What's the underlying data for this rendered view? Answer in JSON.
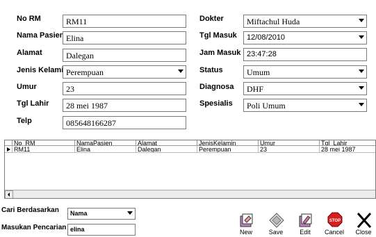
{
  "form": {
    "left": [
      {
        "label": "No RM",
        "value": "RM11",
        "type": "text"
      },
      {
        "label": "Nama Pasien",
        "value": "Elina",
        "type": "text"
      },
      {
        "label": "Alamat",
        "value": "Dalegan",
        "type": "text"
      },
      {
        "label": "Jenis Kelamin",
        "value": "Perempuan",
        "type": "select"
      },
      {
        "label": "Umur",
        "value": "23",
        "type": "text"
      },
      {
        "label": "Tgl Lahir",
        "value": "28 mei 1987",
        "type": "text"
      },
      {
        "label": "Telp",
        "value": "085648166287",
        "type": "text"
      }
    ],
    "right": [
      {
        "label": "Dokter",
        "value": "Miftachul Huda",
        "type": "select"
      },
      {
        "label": "Tgl Masuk",
        "value": "12/08/2010",
        "type": "select"
      },
      {
        "label": "Jam Masuk",
        "value": "23:47:28",
        "type": "text"
      },
      {
        "label": "Status",
        "value": "Umum",
        "type": "select"
      },
      {
        "label": "Diagnosa",
        "value": "DHF",
        "type": "select"
      },
      {
        "label": "Spesialis",
        "value": "Poli Umum",
        "type": "select"
      }
    ]
  },
  "grid": {
    "columns": [
      "No_RM",
      "NamaPasien",
      "Alamat",
      "JenisKelamin",
      "Umur",
      "Tgl_Lahir"
    ],
    "rows": [
      [
        "RM11",
        "Elina",
        "Dalegan",
        "Perempuan",
        "23",
        "28 mei 1987"
      ]
    ]
  },
  "search": {
    "by_label": "Cari Berdasarkan",
    "by_value": "Nama",
    "query_label": "Masukan Pencarian",
    "query_value": "elina"
  },
  "buttons": {
    "new": "New",
    "save": "Save",
    "edit": "Edit",
    "cancel": "Cancel",
    "close": "Close",
    "stop_text": "STOP"
  }
}
